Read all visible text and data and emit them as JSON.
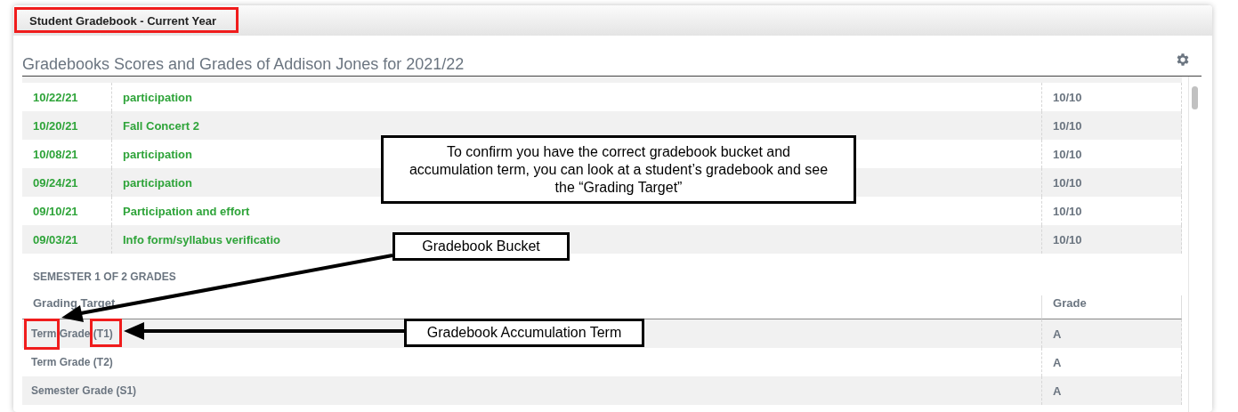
{
  "panel": {
    "tab_title": "Student Gradebook - Current Year",
    "heading": "Gradebooks Scores and Grades of Addison Jones for 2021/22"
  },
  "scores": [
    {
      "date": "10/22/21",
      "assignment": "participation",
      "score": "10/10"
    },
    {
      "date": "10/20/21",
      "assignment": "Fall Concert 2",
      "score": "10/10"
    },
    {
      "date": "10/08/21",
      "assignment": "participation",
      "score": "10/10"
    },
    {
      "date": "09/24/21",
      "assignment": "participation",
      "score": "10/10"
    },
    {
      "date": "09/10/21",
      "assignment": "Participation and effort",
      "score": "10/10"
    },
    {
      "date": "09/03/21",
      "assignment": "Info form/syllabus verificatio",
      "score": "10/10"
    }
  ],
  "grades_section": {
    "title": "SEMESTER 1 OF 2 GRADES",
    "columns": [
      "Grading Target",
      "Grade"
    ],
    "rows": [
      {
        "target": "Term Grade (T1)",
        "grade": "A"
      },
      {
        "target": "Term Grade (T2)",
        "grade": "A"
      },
      {
        "target": "Semester Grade (S1)",
        "grade": "A"
      }
    ]
  },
  "annotations": [
    {
      "kind": "note",
      "text": "To confirm you have the correct gradebook bucket and accumulation term, you can look at a student’s gradebook and see the “Grading Target”"
    },
    {
      "kind": "label",
      "text": "Gradebook Bucket"
    },
    {
      "kind": "label",
      "text": "Gradebook Accumulation Term"
    }
  ]
}
